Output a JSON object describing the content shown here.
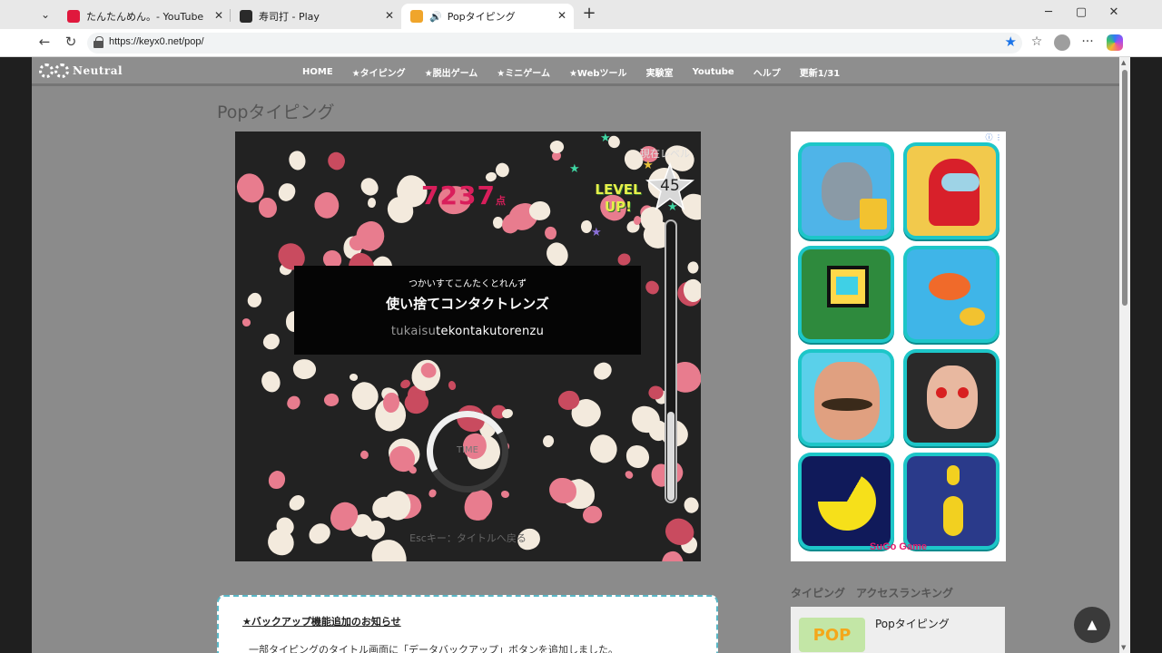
{
  "browser": {
    "tabs": [
      {
        "title": "たんたんめん。- YouTube",
        "favicon_color": "#e0183d"
      },
      {
        "title": "寿司打 - Play",
        "favicon_color": "#2a2a2a"
      },
      {
        "title": "Popタイピング",
        "favicon_color": "#f0a52b",
        "active": true
      }
    ],
    "url": "https://keyx0.net/pop/"
  },
  "site": {
    "logo": "Neutral",
    "nav": [
      "HOME",
      "★タイピング",
      "★脱出ゲーム",
      "★ミニゲーム",
      "★Webツール",
      "実験室",
      "Youtube",
      "ヘルプ",
      "更新1/31"
    ],
    "page_title": "Popタイピング"
  },
  "game": {
    "score": "7237",
    "score_unit": "点",
    "level_label": "現在レベル",
    "level_up_line1": "LEVEL",
    "level_up_line2": "UP!",
    "level": "45",
    "prompt_kana": "つかいすてこんたくとれんず",
    "prompt_text": "使い捨てコンタクトレンズ",
    "romaji_typed": "tukaisu",
    "romaji_remaining": "tekontakutorenzu",
    "timer_label": "TIME",
    "gauge_fraction": 0.32,
    "esc_hint": "Escキー：タイトルへ戻る"
  },
  "ad": {
    "brand": "SuGo Game",
    "info_icon": "info-icon",
    "games": [
      {
        "icon": "talking-tom-icon",
        "bg": "#4fb4e8"
      },
      {
        "icon": "among-us-icon",
        "bg": "#f2c94c"
      },
      {
        "icon": "geometry-dash-icon",
        "bg": "#2e8a3d"
      },
      {
        "icon": "fish-game-icon",
        "bg": "#3fb5e8"
      },
      {
        "icon": "hello-neighbor-icon",
        "bg": "#5ad0ea"
      },
      {
        "icon": "baby-in-yellow-icon",
        "bg": "#2a2a2a"
      },
      {
        "icon": "pacman-icon",
        "bg": "#101a5a"
      },
      {
        "icon": "minion-rush-icon",
        "bg": "#2a3a8a"
      }
    ]
  },
  "ranking": {
    "title": "タイピング　アクセスランキング",
    "items": [
      {
        "label": "Popタイピング",
        "thumb": "POP"
      }
    ]
  },
  "notice": {
    "title": "★バックアップ機能追加のお知らせ",
    "body": "一部タイピングのタイトル画面に「データバックアップ」ボタンを追加しました。"
  },
  "to_top_icon": "arrow-up-icon"
}
